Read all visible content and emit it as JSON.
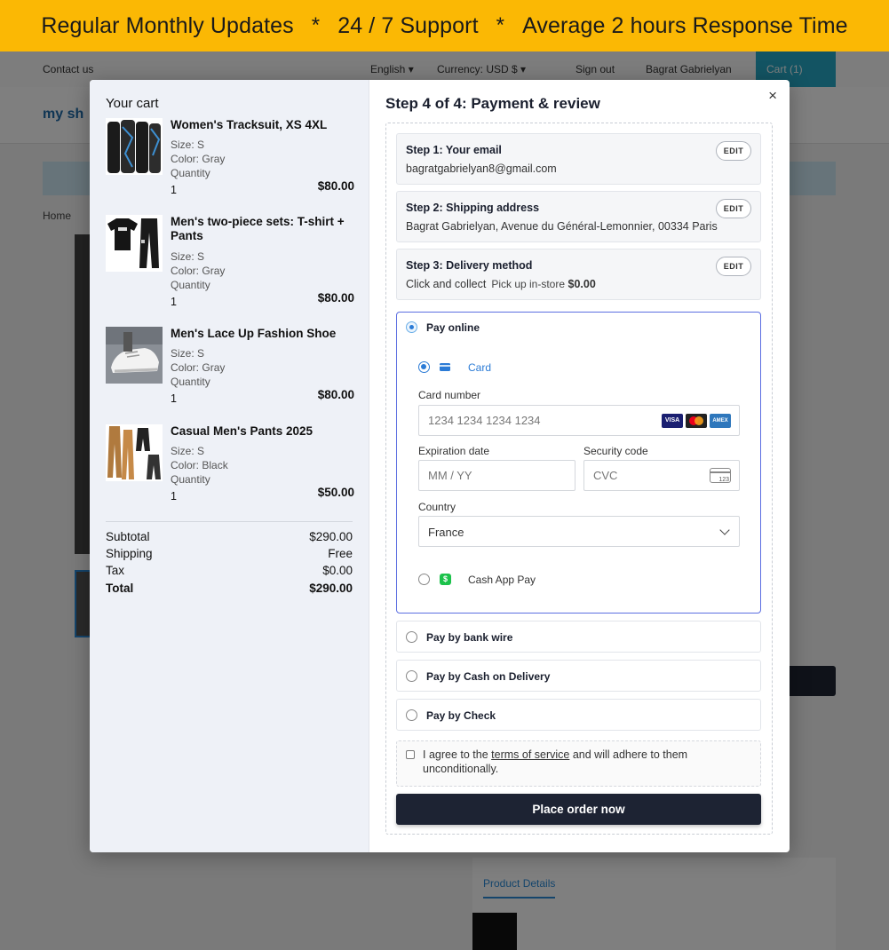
{
  "banner": {
    "item1": "Regular Monthly Updates",
    "sep1": "*",
    "item2": "24 / 7 Support",
    "sep2": "*",
    "item3": "Average 2 hours Response Time"
  },
  "background": {
    "contact_us": "Contact us",
    "language": "English ▾",
    "currency": "Currency: USD $ ▾",
    "sign_out": "Sign out",
    "user_name": "Bagrat Gabrielyan",
    "cart": "Cart (1)",
    "logo": "my sh",
    "breadcrumb": "Home",
    "product_details_tab": "Product Details"
  },
  "cart": {
    "title": "Your cart",
    "size_label": "Size:",
    "color_label": "Color:",
    "quantity_label": "Quantity",
    "items": [
      {
        "name": "Women's Tracksuit, XS 4XL",
        "size": "S",
        "color": "Gray",
        "qty": "1",
        "price": "$80.00"
      },
      {
        "name": "Men's two-piece sets: T-shirt + Pants",
        "size": "S",
        "color": "Gray",
        "qty": "1",
        "price": "$80.00"
      },
      {
        "name": "Men's Lace Up Fashion Shoe",
        "size": "S",
        "color": "Gray",
        "qty": "1",
        "price": "$80.00"
      },
      {
        "name": "Casual Men's Pants 2025",
        "size": "S",
        "color": "Black",
        "qty": "1",
        "price": "$50.00"
      }
    ],
    "summary": {
      "subtotal_label": "Subtotal",
      "subtotal": "$290.00",
      "shipping_label": "Shipping",
      "shipping": "Free",
      "tax_label": "Tax",
      "tax": "$0.00",
      "total_label": "Total",
      "total": "$290.00"
    }
  },
  "checkout": {
    "close": "×",
    "title": "Step 4 of 4: Payment & review",
    "edit_label": "EDIT",
    "step1": {
      "title": "Step 1: Your email",
      "value": "bagratgabrielyan8@gmail.com"
    },
    "step2": {
      "title": "Step 2: Shipping address",
      "value": "Bagrat Gabrielyan, Avenue du Général-Lemonnier, 00334 Paris"
    },
    "step3": {
      "title": "Step 3: Delivery method",
      "method": "Click and collect",
      "detail": "Pick up in-store",
      "price": "$0.00"
    },
    "pay_online": {
      "label": "Pay online",
      "card_label": "Card",
      "card_number_label": "Card number",
      "card_number_placeholder": "1234 1234 1234 1234",
      "expiration_label": "Expiration date",
      "expiration_placeholder": "MM / YY",
      "security_label": "Security code",
      "security_placeholder": "CVC",
      "cvc_icon_text": "123",
      "country_label": "Country",
      "country_value": "France",
      "cashapp_label": "Cash App Pay",
      "card_brands": [
        "VISA",
        "",
        "AMEX"
      ]
    },
    "other_methods": {
      "bank_wire": "Pay by bank wire",
      "cod": "Pay by Cash on Delivery",
      "check": "Pay by Check"
    },
    "terms": {
      "prefix": "I agree to the ",
      "link": "terms of service",
      "suffix": " and will adhere to them unconditionally."
    },
    "place_order": "Place order now"
  },
  "colors": {
    "banner": "#fbb804",
    "accent": "#5b6ee1",
    "radio": "#2b7bd6",
    "button": "#1d2333",
    "cashapp": "#1cc24b"
  }
}
